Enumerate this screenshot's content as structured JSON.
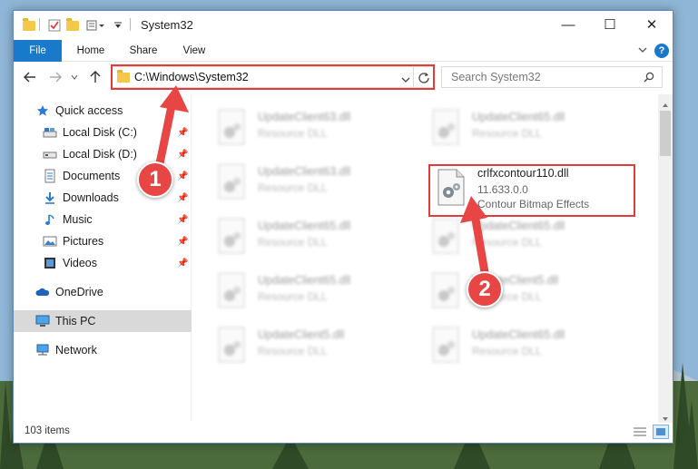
{
  "window": {
    "title": "System32",
    "controls": {
      "minimize": "—",
      "maximize": "☐",
      "close": "✕"
    }
  },
  "ribbon": {
    "tabs": [
      "File",
      "Home",
      "Share",
      "View"
    ]
  },
  "address_bar": {
    "path": "C:\\Windows\\System32"
  },
  "search": {
    "placeholder": "Search System32"
  },
  "sidebar": {
    "quick_access": "Quick access",
    "items": [
      {
        "label": "Local Disk (C:)",
        "icon": "drive-icon"
      },
      {
        "label": "Local Disk (D:)",
        "icon": "drive-icon"
      },
      {
        "label": "Documents",
        "icon": "documents-icon"
      },
      {
        "label": "Downloads",
        "icon": "downloads-icon"
      },
      {
        "label": "Music",
        "icon": "music-icon"
      },
      {
        "label": "Pictures",
        "icon": "pictures-icon"
      },
      {
        "label": "Videos",
        "icon": "videos-icon"
      }
    ],
    "onedrive": "OneDrive",
    "this_pc": "This PC",
    "network": "Network"
  },
  "files": {
    "left_column": [
      {
        "name": "UpdateClient63.dll",
        "type": "Resource DLL"
      },
      {
        "name": "UpdateClient63.dll",
        "type": "Resource DLL"
      },
      {
        "name": "UpdateClient65.dll",
        "type": "Resource DLL"
      },
      {
        "name": "UpdateClient65.dll",
        "type": "Resource DLL"
      },
      {
        "name": "UpdateClient5.dll",
        "type": "Resource DLL"
      }
    ],
    "right_column": [
      {
        "name": "UpdateClient65.dll",
        "type": "Resource DLL"
      },
      {
        "name": "UpdateClient65.dll",
        "type": "Resource DLL"
      },
      {
        "name": "UpdateClient5.dll",
        "type": "Resource DLL"
      },
      {
        "name": "UpdateClient65.dll",
        "type": "Resource DLL"
      }
    ],
    "highlighted": {
      "name": "crlfxcontour110.dll",
      "version": "11.633.0.0",
      "description": "Contour Bitmap Effects"
    }
  },
  "status_bar": {
    "item_count": "103 items"
  },
  "annotations": {
    "step1": "1",
    "step2": "2",
    "color": "#e84545"
  }
}
